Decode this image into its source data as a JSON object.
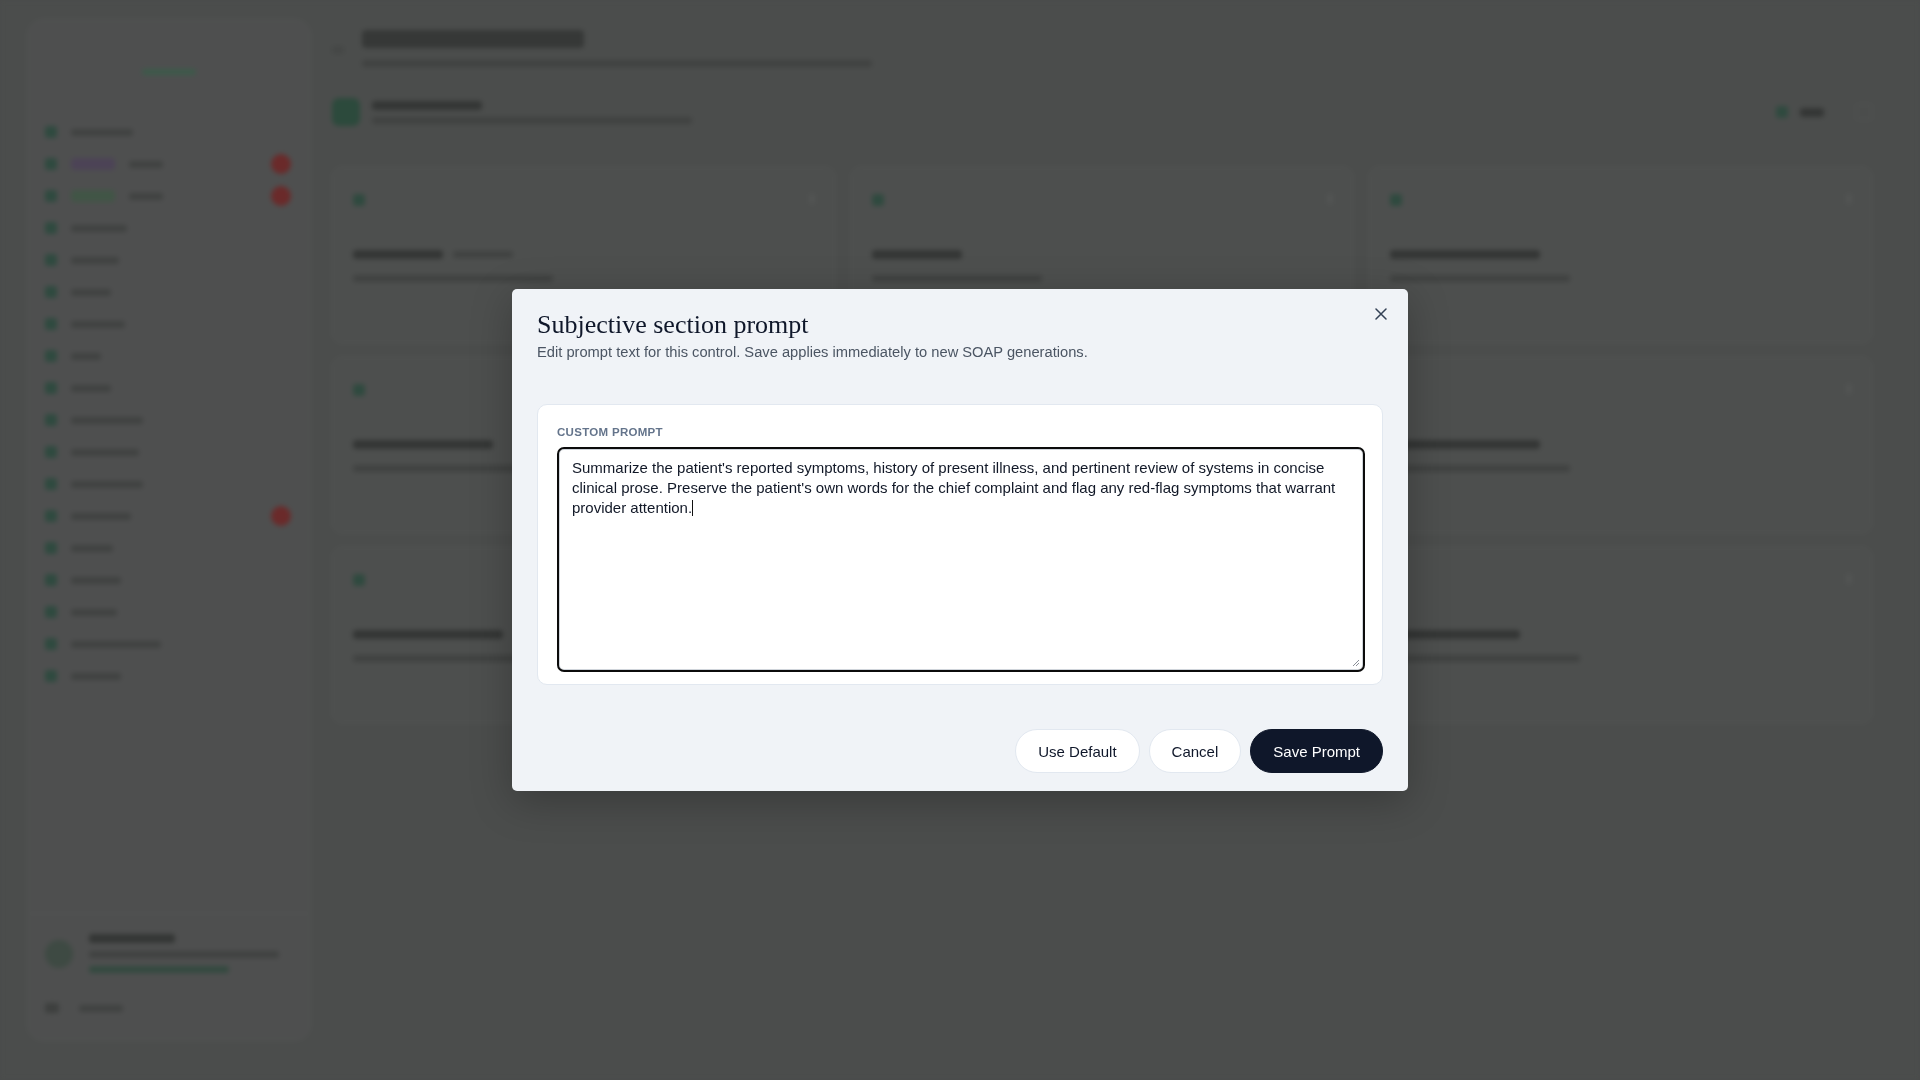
{
  "dialog": {
    "title": "Subjective section prompt",
    "description": "Edit prompt text for this control. Save applies immediately to new SOAP generations.",
    "field": {
      "label": "CUSTOM PROMPT",
      "value": "Summarize the patient's reported symptoms, history of present illness, and pertinent review of systems in concise clinical prose. Preserve the patient's own words for the chief complaint and flag any red-flag symptoms that warrant provider attention.",
      "focused": true
    },
    "buttons": [
      {
        "label": "Use Default",
        "kind": "secondary"
      },
      {
        "label": "Cancel",
        "kind": "secondary"
      },
      {
        "label": "Save Prompt",
        "kind": "primary"
      }
    ]
  }
}
